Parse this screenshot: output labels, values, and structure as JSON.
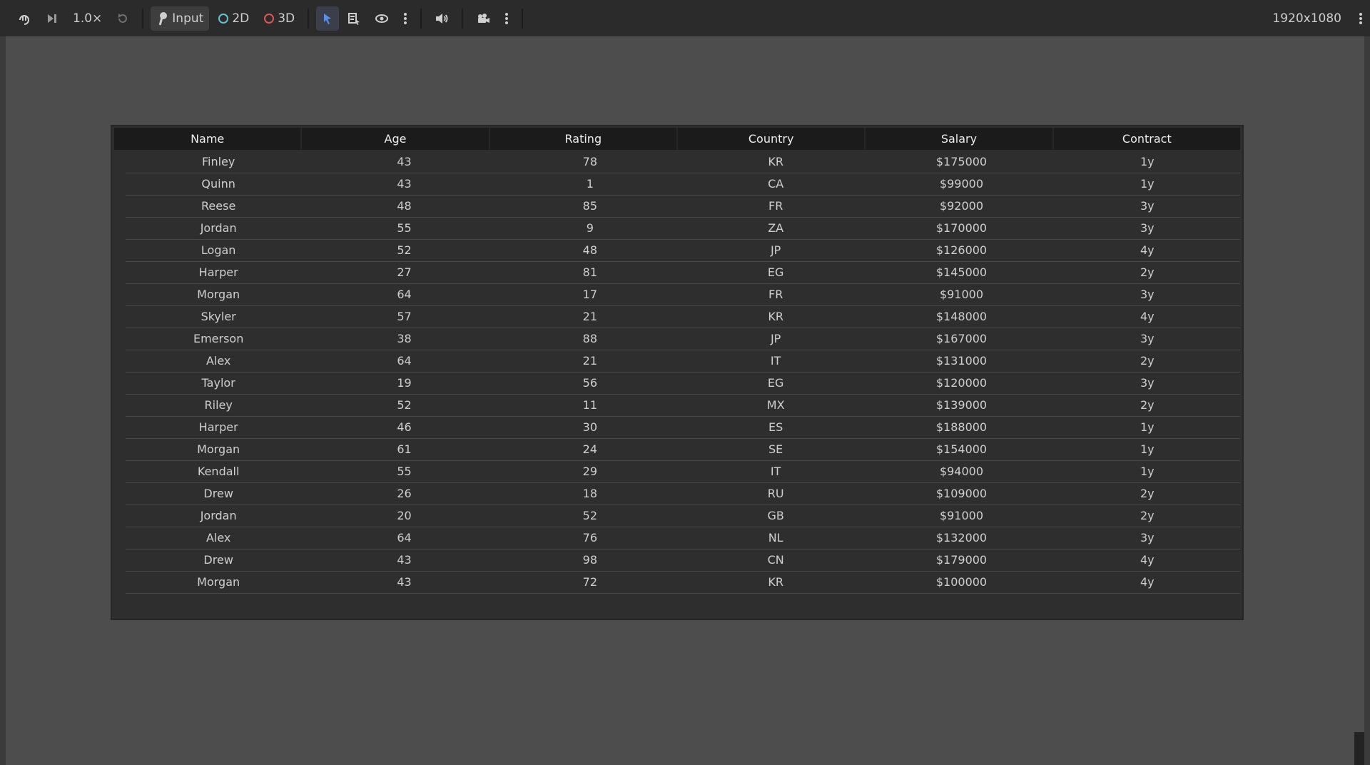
{
  "toolbar": {
    "speed": "1.0×",
    "input_label": "Input",
    "label_2d": "2D",
    "label_3d": "3D",
    "resolution": "1920x1080",
    "colors": {
      "accent_blue": "#5a8fe6",
      "ring_2d": "#66c2d1",
      "ring_3d": "#e05555"
    }
  },
  "table": {
    "columns": [
      "Name",
      "Age",
      "Rating",
      "Country",
      "Salary",
      "Contract"
    ],
    "rows": [
      [
        "Finley",
        "43",
        "78",
        "KR",
        "$175000",
        "1y"
      ],
      [
        "Quinn",
        "43",
        "1",
        "CA",
        "$99000",
        "1y"
      ],
      [
        "Reese",
        "48",
        "85",
        "FR",
        "$92000",
        "3y"
      ],
      [
        "Jordan",
        "55",
        "9",
        "ZA",
        "$170000",
        "3y"
      ],
      [
        "Logan",
        "52",
        "48",
        "JP",
        "$126000",
        "4y"
      ],
      [
        "Harper",
        "27",
        "81",
        "EG",
        "$145000",
        "2y"
      ],
      [
        "Morgan",
        "64",
        "17",
        "FR",
        "$91000",
        "3y"
      ],
      [
        "Skyler",
        "57",
        "21",
        "KR",
        "$148000",
        "4y"
      ],
      [
        "Emerson",
        "38",
        "88",
        "JP",
        "$167000",
        "3y"
      ],
      [
        "Alex",
        "64",
        "21",
        "IT",
        "$131000",
        "2y"
      ],
      [
        "Taylor",
        "19",
        "56",
        "EG",
        "$120000",
        "3y"
      ],
      [
        "Riley",
        "52",
        "11",
        "MX",
        "$139000",
        "2y"
      ],
      [
        "Harper",
        "46",
        "30",
        "ES",
        "$188000",
        "1y"
      ],
      [
        "Morgan",
        "61",
        "24",
        "SE",
        "$154000",
        "1y"
      ],
      [
        "Kendall",
        "55",
        "29",
        "IT",
        "$94000",
        "1y"
      ],
      [
        "Drew",
        "26",
        "18",
        "RU",
        "$109000",
        "2y"
      ],
      [
        "Jordan",
        "20",
        "52",
        "GB",
        "$91000",
        "2y"
      ],
      [
        "Alex",
        "64",
        "76",
        "NL",
        "$132000",
        "3y"
      ],
      [
        "Drew",
        "43",
        "98",
        "CN",
        "$179000",
        "4y"
      ],
      [
        "Morgan",
        "43",
        "72",
        "KR",
        "$100000",
        "4y"
      ]
    ]
  }
}
